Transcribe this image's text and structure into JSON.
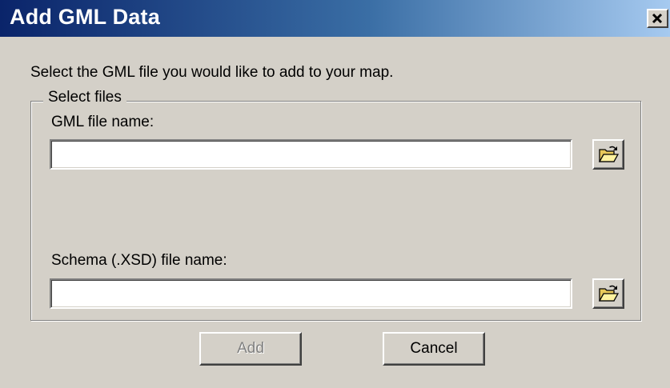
{
  "window": {
    "title": "Add GML Data",
    "title_gradient": [
      "#0a246a",
      "#a6caf0"
    ],
    "close_icon": "close-icon"
  },
  "prompt": "Select the GML file you would like to add to your map.",
  "group": {
    "legend": "Select files",
    "gml": {
      "label": "GML file name:",
      "value": "",
      "browse_icon": "open-folder-icon"
    },
    "schema": {
      "label": "Schema (.XSD) file name:",
      "value": "",
      "browse_icon": "open-folder-icon"
    }
  },
  "buttons": {
    "add": {
      "label": "Add",
      "enabled": false
    },
    "cancel": {
      "label": "Cancel",
      "enabled": true
    }
  }
}
